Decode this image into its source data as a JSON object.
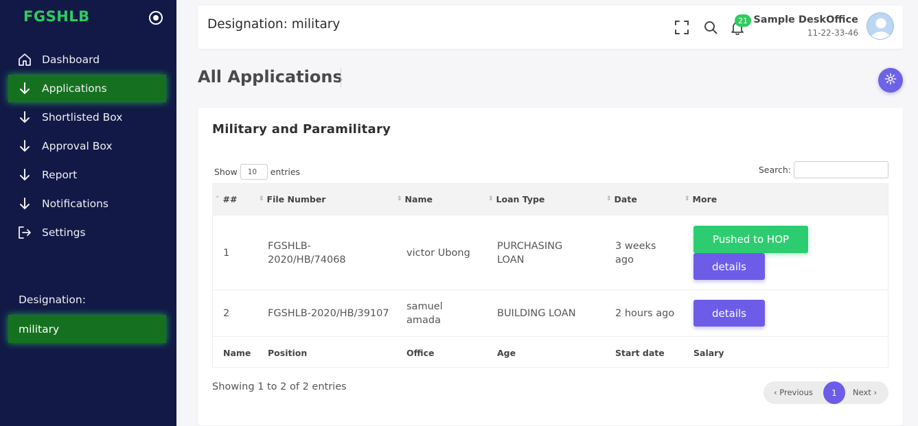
{
  "sidebar": {
    "brand": "FGSHLB",
    "items": [
      {
        "label": "Dashboard",
        "icon": "home-icon"
      },
      {
        "label": "Applications",
        "icon": "arrow-down-icon",
        "active": true
      },
      {
        "label": "Shortlisted Box",
        "icon": "arrow-down-icon"
      },
      {
        "label": "Approval Box",
        "icon": "arrow-down-icon"
      },
      {
        "label": "Report",
        "icon": "arrow-down-icon"
      },
      {
        "label": "Notifications",
        "icon": "arrow-down-icon"
      },
      {
        "label": "Settings",
        "icon": "logout-icon"
      }
    ],
    "designation_label": "Designation:",
    "designation_value": "military"
  },
  "header": {
    "title": "Designation: military",
    "notification_count": "21",
    "user_name": "Sample DeskOffice",
    "user_id": "11-22-33-46",
    "icons": [
      "fullscreen-icon",
      "search-icon",
      "bell-icon",
      "avatar"
    ]
  },
  "page": {
    "title": "All Applications",
    "settings_icon": "gear-icon"
  },
  "card": {
    "title": "Military and Paramilitary",
    "show_label": "Show",
    "entries_value": "10",
    "entries_label": "entries",
    "search_label": "Search:",
    "columns": [
      "##",
      "File Number",
      "Name",
      "Loan Type",
      "Date",
      "More"
    ],
    "rows": [
      {
        "num": "1",
        "file": "FGSHLB-2020/HB/74068",
        "name": "victor Ubong",
        "loan": "PURCHASING LOAN",
        "date": "3 weeks ago",
        "pushed_label": "Pushed to HOP",
        "details_label": "details"
      },
      {
        "num": "2",
        "file": "FGSHLB-2020/HB/39107",
        "name": "samuel amada",
        "loan": "BUILDING LOAN",
        "date": "2 hours ago",
        "details_label": "details"
      }
    ],
    "footer_columns": [
      "Name",
      "Position",
      "Office",
      "Age",
      "Start date",
      "Salary"
    ],
    "info": "Showing 1 to 2 of 2 entries",
    "pagination": {
      "prev": "Previous",
      "current": "1",
      "next": "Next"
    }
  },
  "colors": {
    "sidebar_bg": "#121946",
    "brand_green": "#2ecc5e",
    "active_green": "#15711f",
    "accent_purple": "#6c5ce7",
    "button_green": "#2ecc71"
  }
}
